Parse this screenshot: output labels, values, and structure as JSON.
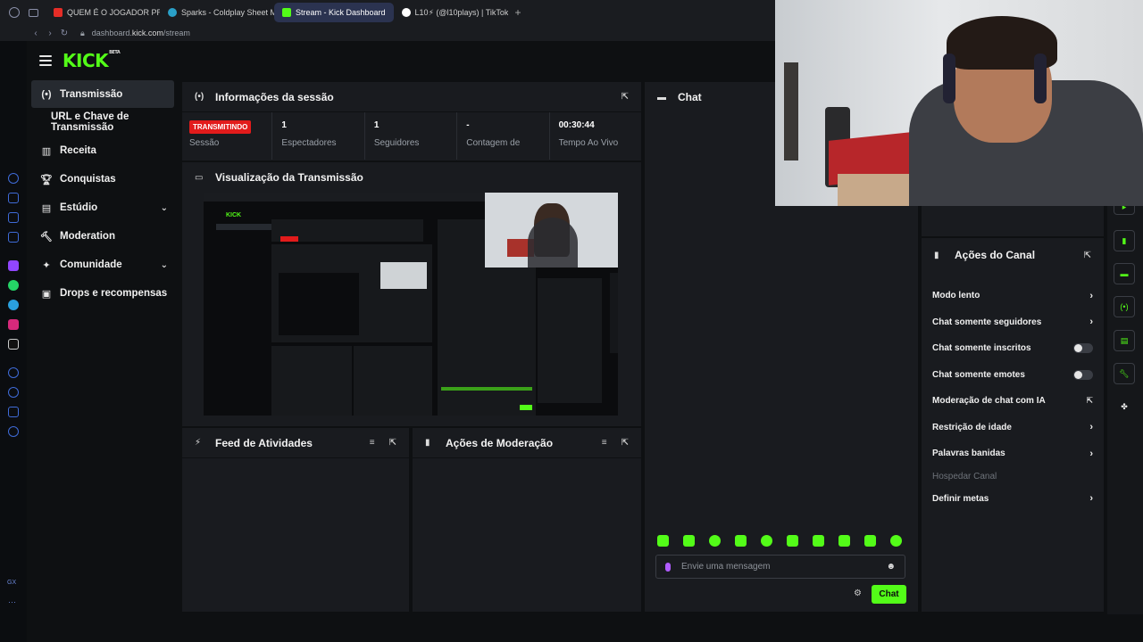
{
  "browser": {
    "tabs": [
      {
        "label": "QUEM É O JOGADOR PRO",
        "color": "#e52d27"
      },
      {
        "label": "Sparks - Coldplay Sheet M",
        "color": "#2aa0c8"
      },
      {
        "label": "Stream - Kick Dashboard",
        "color": "#53fc18"
      },
      {
        "label": "L10⚡ (@l10plays) | TikTok",
        "color": "#ffffff"
      }
    ],
    "url_prefix": "dashboard.",
    "url_domain": "kick.com",
    "url_path": "/stream"
  },
  "app": {
    "logo": "KICK",
    "logo_badge": "BETA"
  },
  "sidebar": {
    "items": [
      {
        "label": "Transmissão",
        "icon": "broadcast-icon"
      },
      {
        "label": "URL e Chave de Transmissão",
        "icon": ""
      },
      {
        "label": "Receita",
        "icon": "chart-icon"
      },
      {
        "label": "Conquistas",
        "icon": "trophy-icon"
      },
      {
        "label": "Estúdio",
        "icon": "studio-icon"
      },
      {
        "label": "Moderation",
        "icon": "hammer-icon"
      },
      {
        "label": "Comunidade",
        "icon": "community-icon"
      },
      {
        "label": "Drops e recompensas",
        "icon": "gift-icon"
      }
    ]
  },
  "session": {
    "title": "Informações da sessão",
    "status": "TRANSMITINDO",
    "status_label": "Sessão",
    "viewers": "1",
    "viewers_label": "Espectadores",
    "followers": "1",
    "followers_label": "Seguidores",
    "subs": "-",
    "subs_label": "Contagem de Inscritos",
    "uptime": "00:30:44",
    "uptime_label": "Tempo Ao Vivo"
  },
  "preview": {
    "title": "Visualização da Transmissão"
  },
  "activity": {
    "title": "Feed de Atividades"
  },
  "modactions": {
    "title": "Ações de Moderação"
  },
  "chat": {
    "title": "Chat",
    "placeholder": "Envie uma mensagem",
    "send_label": "Chat"
  },
  "channel_actions": {
    "title": "Ações do Canal",
    "items": [
      {
        "label": "Modo lento",
        "control": "chevron"
      },
      {
        "label": "Chat somente seguidores",
        "control": "chevron"
      },
      {
        "label": "Chat somente inscritos",
        "control": "toggle",
        "on": false
      },
      {
        "label": "Chat somente emotes",
        "control": "toggle",
        "on": false
      },
      {
        "label": "Moderação de chat com IA",
        "control": "external"
      },
      {
        "label": "Restrição de idade",
        "control": "chevron"
      },
      {
        "label": "Palavras banidas",
        "control": "chevron"
      },
      {
        "label": "Hospedar Canal",
        "control": "none",
        "disabled": true
      },
      {
        "label": "Definir metas",
        "control": "chevron"
      }
    ]
  },
  "colors": {
    "accent": "#53fc18",
    "live": "#e21b1b",
    "panel": "#191b1f",
    "bg": "#0e1012"
  }
}
